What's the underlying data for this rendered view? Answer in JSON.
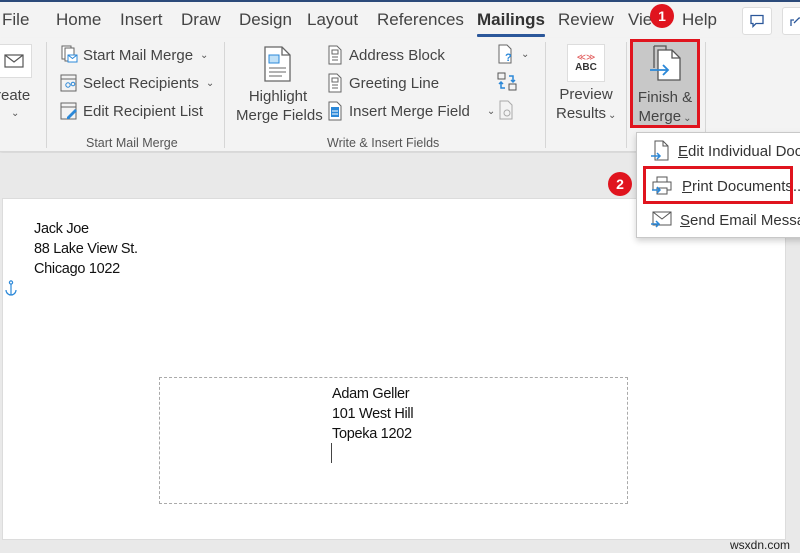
{
  "tabs": [
    {
      "label": "File"
    },
    {
      "label": "Home"
    },
    {
      "label": "Insert"
    },
    {
      "label": "Draw"
    },
    {
      "label": "Design"
    },
    {
      "label": "Layout"
    },
    {
      "label": "References"
    },
    {
      "label": "Mailings",
      "active": true
    },
    {
      "label": "Review"
    },
    {
      "label": "View"
    },
    {
      "label": "Help"
    }
  ],
  "title_buttons": {
    "comments_icon": "comment-icon",
    "share_icon": "share-icon"
  },
  "ribbon": {
    "create": {
      "label": "reate",
      "icon": "envelope-icon"
    },
    "start_mail_merge": {
      "items": [
        {
          "label": "Start Mail Merge",
          "has_dropdown": true,
          "icon": "start-mail-merge-icon"
        },
        {
          "label": "Select Recipients",
          "has_dropdown": true,
          "icon": "select-recipients-icon"
        },
        {
          "label": "Edit Recipient List",
          "has_dropdown": false,
          "icon": "edit-recipient-list-icon"
        }
      ],
      "group_label": "Start Mail Merge"
    },
    "write_insert": {
      "highlight_line1": "Highlight",
      "highlight_line2": "Merge Fields",
      "items": [
        {
          "label": "Address Block",
          "icon": "address-block-icon"
        },
        {
          "label": "Greeting Line",
          "icon": "greeting-line-icon"
        },
        {
          "label": "Insert Merge Field",
          "icon": "insert-merge-field-icon",
          "has_dropdown": true
        }
      ],
      "rules_icon": "rules-icon",
      "match_fields_icon": "match-fields-icon",
      "update_labels_icon": "update-labels-icon",
      "group_label": "Write & Insert Fields"
    },
    "preview": {
      "icon_text": "ABC",
      "line1": "Preview",
      "line2": "Results"
    },
    "finish": {
      "line1": "Finish &",
      "line2": "Merge"
    }
  },
  "dropdown_menu": {
    "items": [
      {
        "label": "Edit Individual Documents...",
        "underline": "E",
        "rest": "dit Individual Documents...",
        "icon": "edit-document-icon"
      },
      {
        "label": "Print Documents...",
        "underline": "P",
        "rest": "rint Documents...",
        "icon": "print-icon"
      },
      {
        "label": "Send Email Messages...",
        "underline": "S",
        "rest": "end Email Messages...",
        "icon": "email-icon"
      }
    ]
  },
  "document": {
    "sender": [
      "Jack Joe",
      "88 Lake View St.",
      "Chicago 1022"
    ],
    "recipient": [
      "Adam Geller",
      "101 West Hill",
      "Topeka 1202"
    ]
  },
  "annotations": {
    "step1": "1",
    "step2": "2",
    "color": "#e0141e"
  },
  "watermark": "wsxdn.com"
}
